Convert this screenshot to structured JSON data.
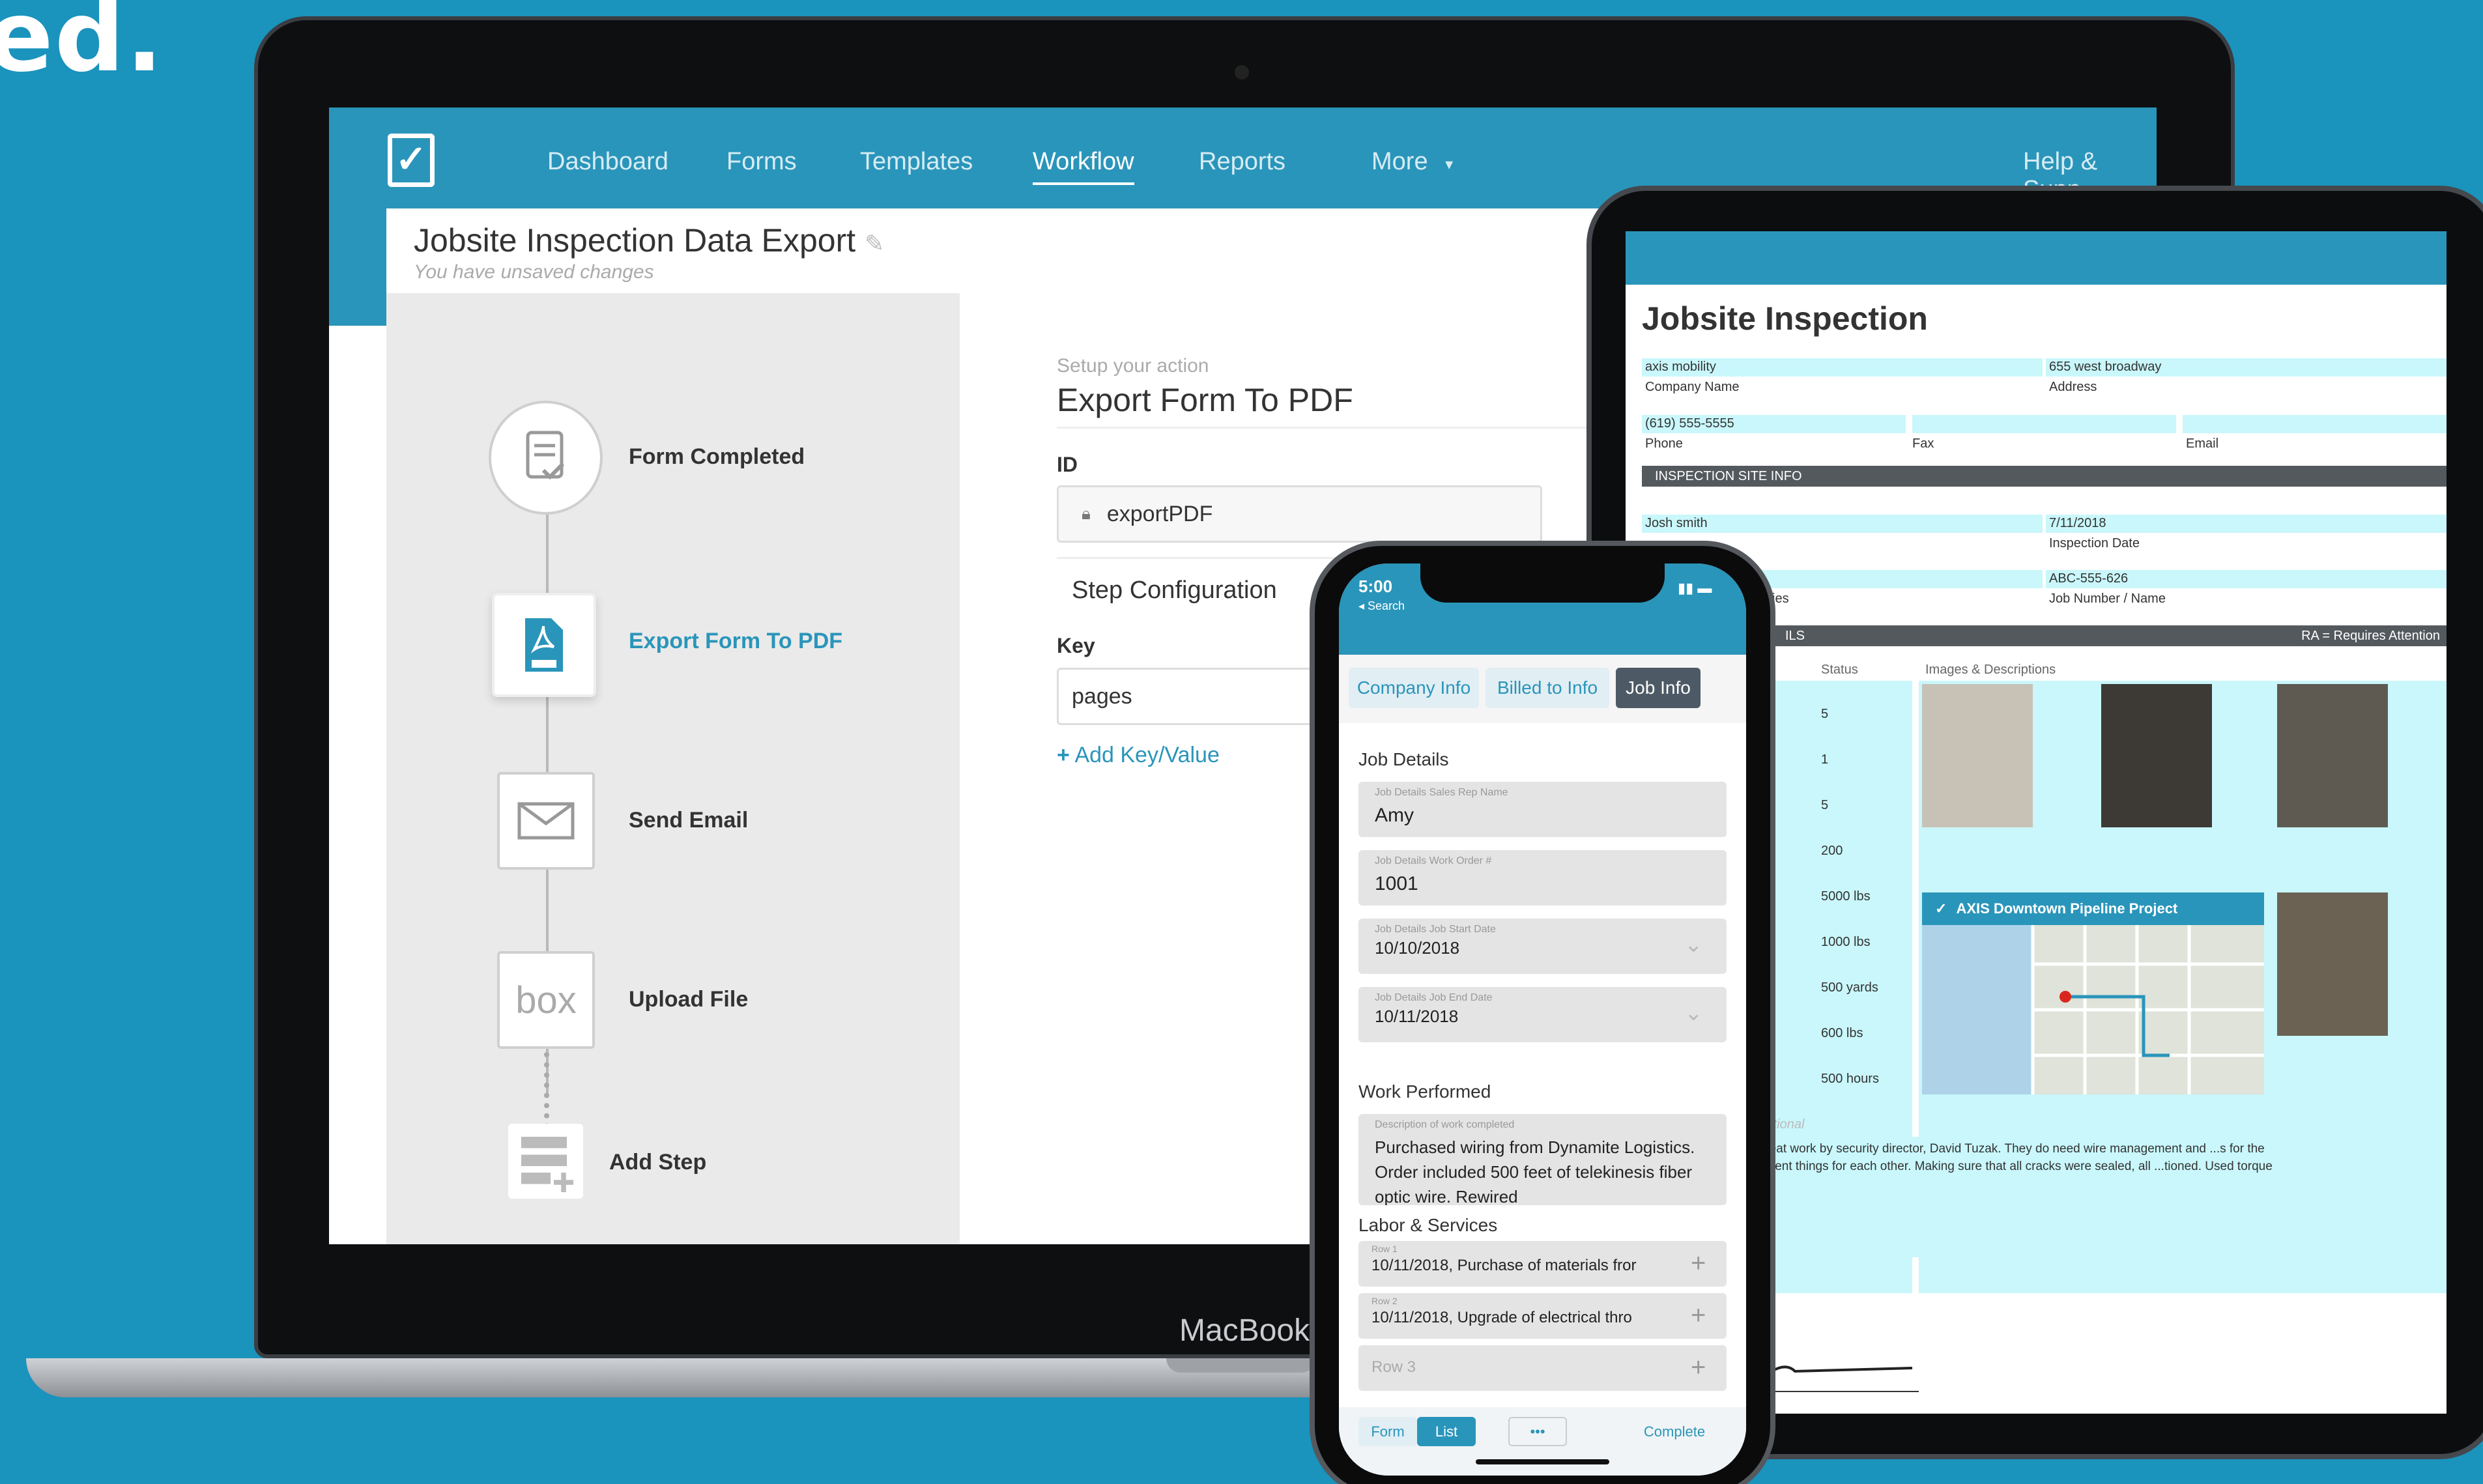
{
  "headline": "ed.",
  "laptop": {
    "device_label": "MacBook",
    "nav": {
      "items": [
        "Dashboard",
        "Forms",
        "Templates",
        "Workflow",
        "Reports",
        "More"
      ],
      "help": "Help & Supp"
    },
    "page": {
      "title": "Jobsite Inspection Data Export",
      "subtitle": "You have unsaved changes"
    },
    "steps": [
      {
        "label": "Form Completed",
        "icon": "form-check-icon"
      },
      {
        "label": "Export Form To PDF",
        "icon": "pdf-icon"
      },
      {
        "label": "Send Email",
        "icon": "envelope-icon"
      },
      {
        "label": "Upload File",
        "icon": "box-logo",
        "logo_text": "box"
      },
      {
        "label": "Add Step",
        "icon": "add-step-icon"
      }
    ],
    "action": {
      "setup_label": "Setup your action",
      "title": "Export Form To PDF",
      "id_label": "ID",
      "id_value": "exportPDF",
      "config_label": "Step Configuration",
      "key_label": "Key",
      "key_value": "pages",
      "add_link": "Add Key/Value"
    }
  },
  "tablet": {
    "title": "Jobsite Inspection",
    "company_name_value": "axis mobility",
    "company_name_label": "Company Name",
    "address_value": "655 west broadway",
    "address_label": "Address",
    "phone_value": "(619) 555-5555",
    "phone_label": "Phone",
    "fax_label": "Fax",
    "email_label": "Email",
    "site_info_header": "INSPECTION SITE INFO",
    "contact_value": "Josh smith",
    "inspection_date_value": "7/11/2018",
    "inspection_date_label": "Inspection Date",
    "job_number_value": "ABC-555-626",
    "job_number_label": "Job Number / Name",
    "trunc_ies": "ies",
    "details_header_frag": "ILS",
    "attention_note": "RA = Requires Attention",
    "status_col": "Status",
    "images_col": "Images & Descriptions",
    "status_values": [
      "5",
      "1",
      "5",
      "200",
      "5000 lbs",
      "1000 lbs",
      "500 yards",
      "600 lbs",
      "500 hours"
    ],
    "map_title": "AXIS Downtown Pipeline Project",
    "optional_label": "Optional",
    "notes": "...ively secure thanks to great work by security director, David Tuzak. They do need wire management and ...s for the lobby. Doing stuff and different things for each other. Making sure that all cracks were sealed, all ...tioned. Used torque wrench to do stuff. Hey"
  },
  "phone": {
    "time": "5:00",
    "back": "◂ Search",
    "tabs": [
      "Company Info",
      "Billed to Info",
      "Job Info"
    ],
    "job_details_header": "Job Details",
    "fields": [
      {
        "label": "Job Details Sales Rep Name",
        "value": "Amy"
      },
      {
        "label": "Job Details Work Order #",
        "value": "1001"
      },
      {
        "label": "Job Details Job Start Date",
        "value": "10/10/2018"
      },
      {
        "label": "Job Details Job End Date",
        "value": "10/11/2018"
      }
    ],
    "work_performed_header": "Work Performed",
    "work_desc_label": "Description of work completed",
    "work_desc_value": "Purchased wiring from Dynamite Logistics. Order included 500 feet of telekinesis fiber optic wire. Rewired",
    "labor_header": "Labor & Services",
    "rows": [
      {
        "label": "Row 1",
        "value": "10/11/2018, Purchase of materials fror"
      },
      {
        "label": "Row 2",
        "value": "10/11/2018, Upgrade of electrical thro"
      },
      {
        "label": "",
        "value": "Row 3"
      }
    ],
    "bottom": {
      "form": "Form",
      "list": "List",
      "more": "•••",
      "complete": "Complete"
    }
  },
  "colors": {
    "background": "#1a93bd",
    "accent": "#2a95ba",
    "highlight": "#c9f7fb"
  }
}
